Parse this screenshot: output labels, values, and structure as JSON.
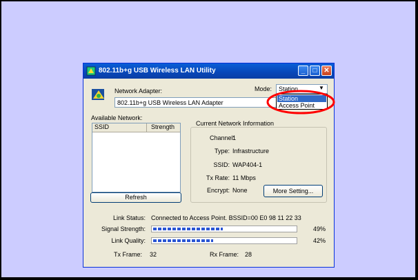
{
  "window": {
    "title": "802.11b+g USB Wireless LAN Utility"
  },
  "adapter": {
    "label": "Network Adapter:",
    "value": "802.11b+g USB Wireless LAN Adapter"
  },
  "mode": {
    "label": "Mode:",
    "selected": "Station",
    "options": [
      "Station",
      "Access Point"
    ],
    "highlight_color": "#ff0000"
  },
  "available": {
    "label": "Available Network:",
    "columns": [
      "SSID",
      "Strength"
    ],
    "refresh_label": "Refresh"
  },
  "current": {
    "title": "Current Network Information",
    "channel_label": "Channel:",
    "channel_value": "1",
    "type_label": "Type:",
    "type_value": "Infrastructure",
    "ssid_label": "SSID:",
    "ssid_value": "WAP404-1",
    "txrate_label": "Tx Rate:",
    "txrate_value": "11 Mbps",
    "encrypt_label": "Encrypt:",
    "encrypt_value": "None",
    "more_label": "More Setting..."
  },
  "status": {
    "link_label": "Link Status:",
    "link_value": "Connected to Access Point. BSSID=00 E0 98 11 22 33",
    "signal_label": "Signal Strength:",
    "signal_value": "49%",
    "signal_level": 0.49,
    "quality_label": "Link Quality:",
    "quality_value": "42%",
    "quality_level": 0.42,
    "tx_label": "Tx Frame:",
    "tx_value": "32",
    "rx_label": "Rx Frame:",
    "rx_value": "28"
  }
}
